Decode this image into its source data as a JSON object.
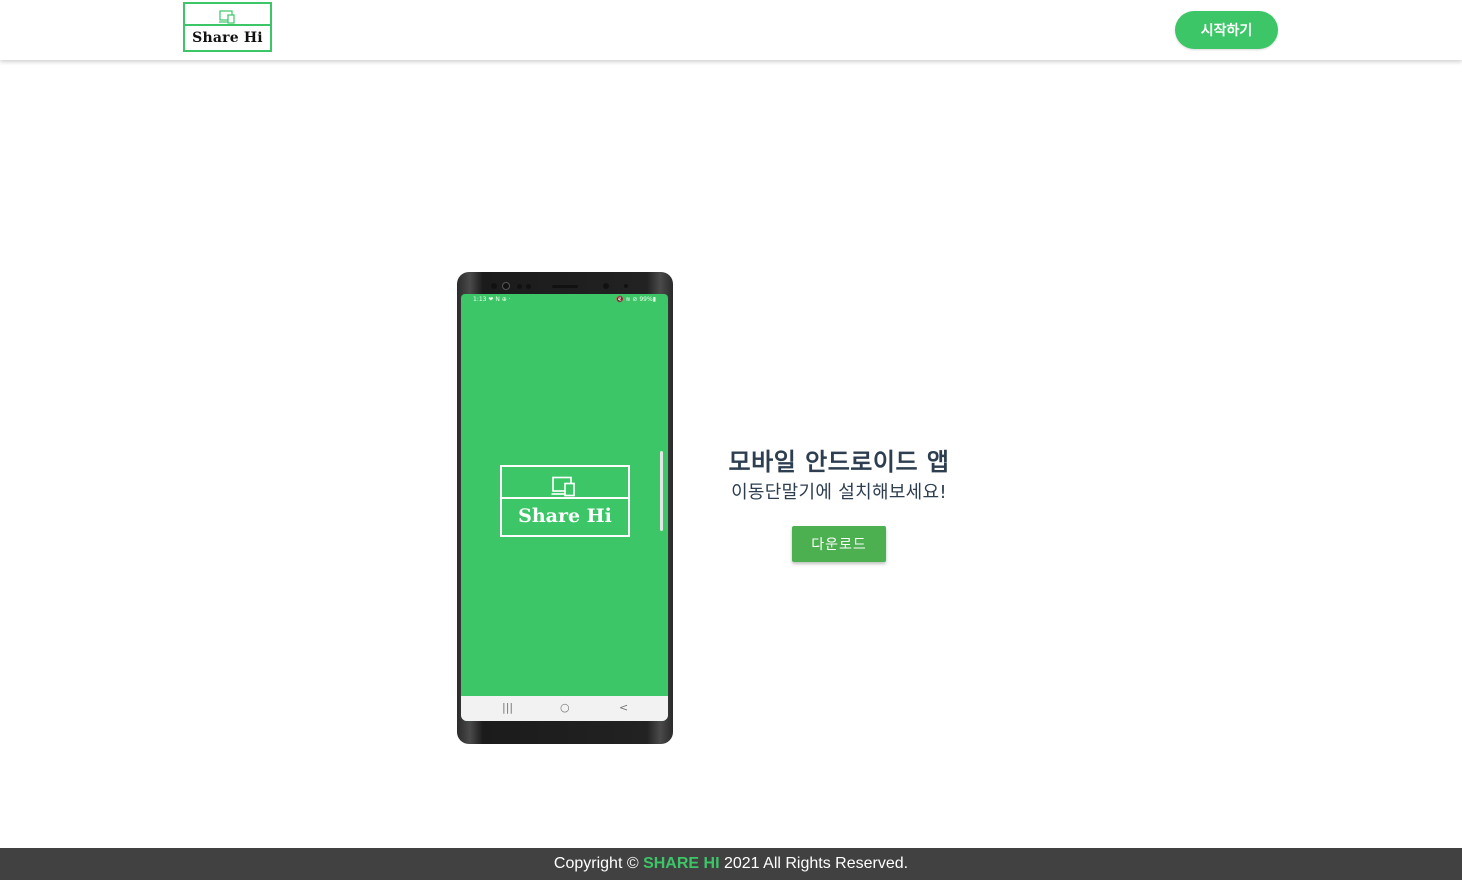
{
  "header": {
    "logo_text": "Share Hi",
    "start_label": "시작하기"
  },
  "phone": {
    "status_left": "1:13 ❤ N ⊕ ·",
    "status_right": "🔇 ≋ ⊘ 99%▮",
    "splash_logo_text": "Share Hi",
    "nav_recent": "|||",
    "nav_home": "○",
    "nav_back": "<"
  },
  "promo": {
    "title": "모바일 안드로이드 앱",
    "subtitle": "이동단말기에 설치해보세요!",
    "download_label": "다운로드"
  },
  "footer": {
    "prefix": "Copyright ©",
    "brand": "SHARE HI",
    "suffix": "2021 All Rights Reserved."
  },
  "colors": {
    "accent": "#3cc667",
    "download_button": "#4caf50",
    "footer_bg": "#414141",
    "text_dark": "#2c3e50"
  },
  "icons": {
    "logo_devices": "devices-icon"
  }
}
